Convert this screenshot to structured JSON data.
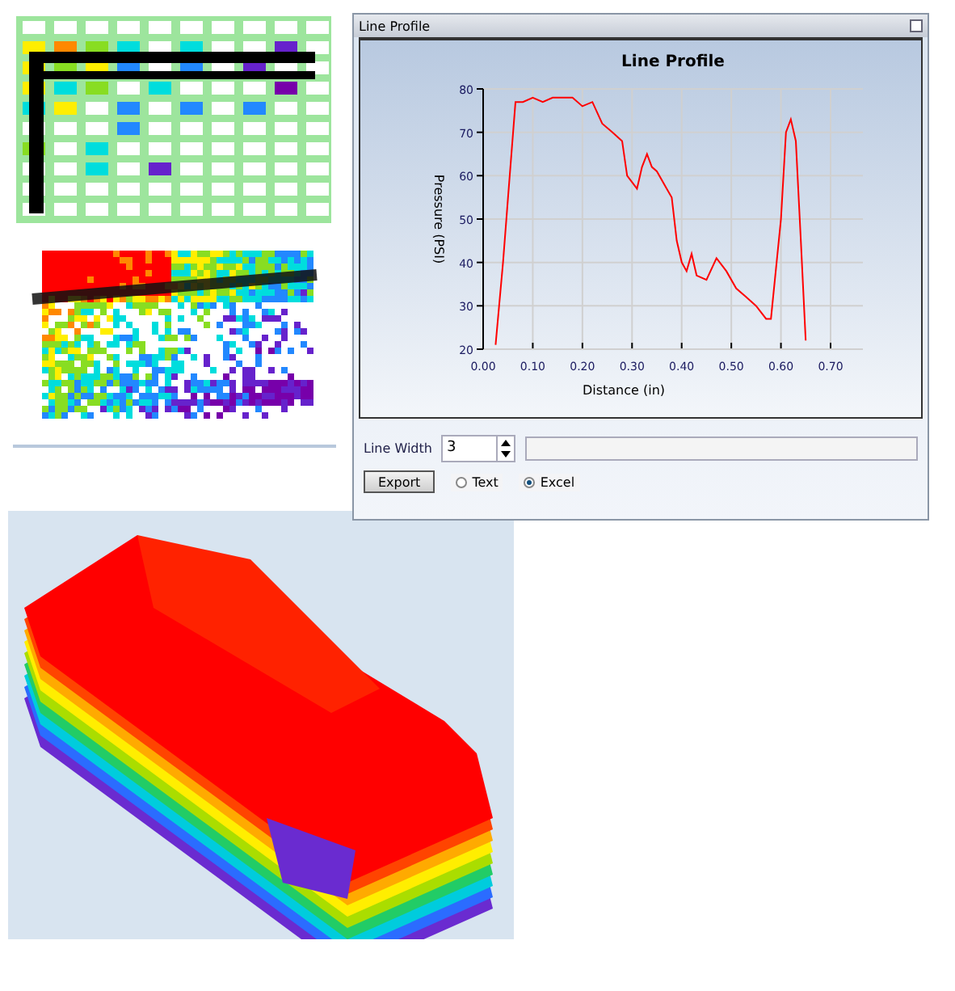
{
  "window": {
    "title": "Line Profile"
  },
  "chart_data": {
    "type": "line",
    "title": "Line Profile",
    "xlabel": "Distance (in)",
    "ylabel": "Pressure (PSI)",
    "xlim": [
      0,
      0.7
    ],
    "ylim": [
      20,
      80
    ],
    "xticks": [
      {
        "value": 0,
        "label": "0.00"
      },
      {
        "value": 0.1,
        "label": "0.10"
      },
      {
        "value": 0.2,
        "label": "0.20"
      },
      {
        "value": 0.3,
        "label": "0.30"
      },
      {
        "value": 0.4,
        "label": "0.40"
      },
      {
        "value": 0.5,
        "label": "0.50"
      },
      {
        "value": 0.6,
        "label": "0.60"
      },
      {
        "value": 0.7,
        "label": "0.70"
      }
    ],
    "yticks": [
      20,
      30,
      40,
      50,
      60,
      70,
      80
    ],
    "x": [
      0.025,
      0.04,
      0.05,
      0.065,
      0.08,
      0.1,
      0.12,
      0.14,
      0.18,
      0.2,
      0.22,
      0.24,
      0.26,
      0.28,
      0.29,
      0.31,
      0.32,
      0.33,
      0.34,
      0.35,
      0.37,
      0.38,
      0.39,
      0.4,
      0.41,
      0.42,
      0.43,
      0.45,
      0.47,
      0.49,
      0.51,
      0.53,
      0.55,
      0.57,
      0.58,
      0.6,
      0.61,
      0.62,
      0.63,
      0.64,
      0.65
    ],
    "grid": true,
    "series": [
      {
        "color": "#ff0000",
        "values": [
          21,
          40,
          55,
          77,
          77,
          78,
          77,
          78,
          78,
          76,
          77,
          72,
          70,
          68,
          60,
          57,
          62,
          65,
          62,
          61,
          57,
          55,
          45,
          40,
          38,
          42,
          37,
          36,
          41,
          38,
          34,
          32,
          30,
          27,
          27,
          50,
          70,
          73,
          68,
          45,
          22
        ]
      }
    ]
  },
  "line_width": {
    "label": "Line Width",
    "value": "3"
  },
  "export_button": "Export",
  "format_options": [
    {
      "label": "Text",
      "selected": false
    },
    {
      "label": "Excel",
      "selected": true
    }
  ]
}
